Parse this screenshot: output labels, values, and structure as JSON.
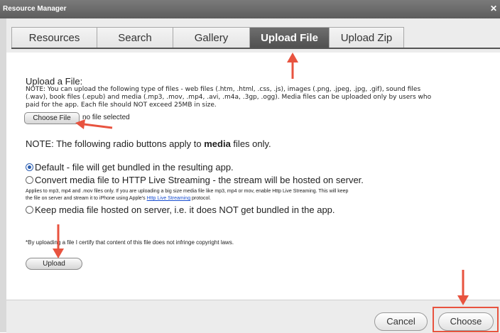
{
  "window": {
    "title": "Resource Manager",
    "close_glyph": "✕"
  },
  "tabs": [
    {
      "label": "Resources",
      "active": false
    },
    {
      "label": "Search",
      "active": false
    },
    {
      "label": "Gallery",
      "active": false
    },
    {
      "label": "Upload File",
      "active": true
    },
    {
      "label": "Upload Zip",
      "active": false
    }
  ],
  "upload": {
    "heading": "Upload a File:",
    "note_line1": "NOTE: You can upload the following type of files - web files (.htm, .html, .css, .js), images (.png, .jpeg, .jpg, .gif), sound files",
    "note_line2": "(.wav), book files (.epub) and media (.mp3, .mov, .mp4, .avi, .m4a, .3gp, .ogg). Media files can be uploaded only by users who",
    "note_line3": "paid for the app. Each file should NOT exceed 25MB in size.",
    "choose_file_label": "Choose File",
    "no_file_text": "no file selected",
    "radio_note_prefix": "NOTE: The following radio buttons apply to ",
    "radio_note_bold": "media",
    "radio_note_suffix": " files only.",
    "option_default": "Default - file will get bundled in the resulting app.",
    "option_streaming": "Convert media file to HTTP Live Streaming - the stream will be hosted on server.",
    "streaming_note_line1": "Applies to mp3, mp4 and .mov files only. If you are uploading a big size media file like mp3, mp4 or mov, enable Http Live Streaming. This will keep",
    "streaming_note_line2_prefix": "the file on server and stream it to iPhone using Apple's ",
    "streaming_note_link": "Http Live Streaming",
    "streaming_note_line2_suffix": " protocol.",
    "option_keep": "Keep media file hosted on server, i.e. it does NOT get bundled in the app.",
    "certify_text": "*By uploading a file I certify that content of this file does not infringe copyright laws.",
    "upload_button_label": "Upload"
  },
  "footer": {
    "cancel_label": "Cancel",
    "choose_label": "Choose"
  },
  "colors": {
    "annotation_arrow": "#e8533f",
    "active_tab": "#5a5a5a",
    "link": "#1a4fd0"
  }
}
